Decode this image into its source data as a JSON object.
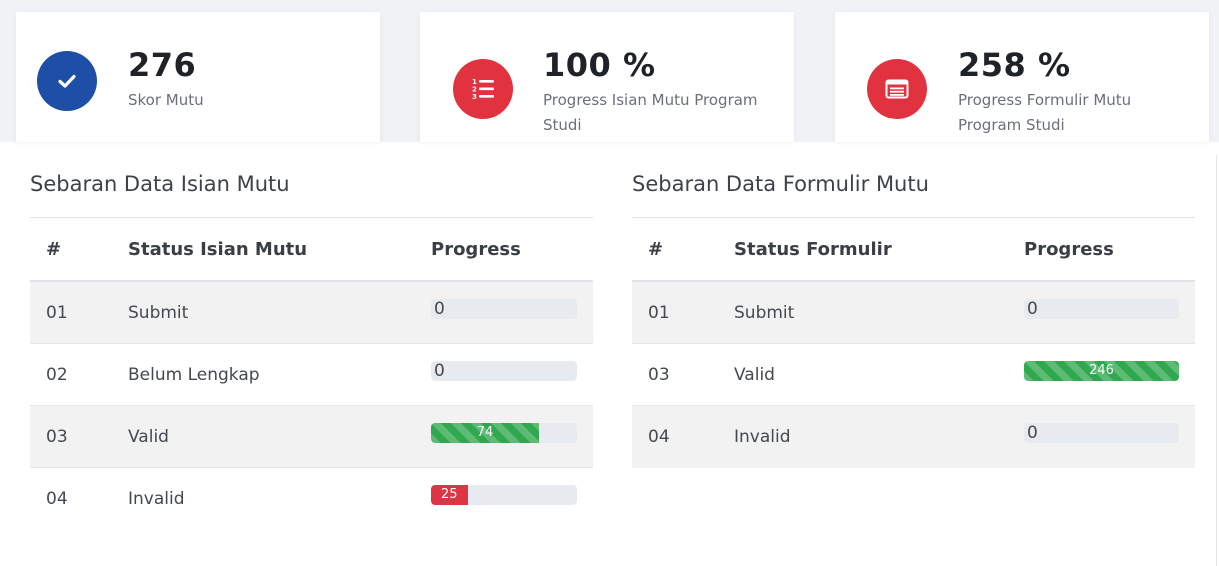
{
  "cards": [
    {
      "value": "276",
      "label": "Skor Mutu",
      "icon": "check-icon",
      "color": "#1e4fa6"
    },
    {
      "value": "100 %",
      "label": "Progress Isian Mutu Program Studi",
      "icon": "numbered-list-icon",
      "color": "#e0323f"
    },
    {
      "value": "258 %",
      "label": "Progress Formulir Mutu Program Studi",
      "icon": "form-list-icon",
      "color": "#e0323f"
    }
  ],
  "isian": {
    "title": "Sebaran Data Isian Mutu",
    "headers": [
      "#",
      "Status Isian Mutu",
      "Progress"
    ],
    "rows": [
      {
        "num": "01",
        "status": "Submit",
        "progress": "0"
      },
      {
        "num": "02",
        "status": "Belum Lengkap",
        "progress": "0"
      },
      {
        "num": "03",
        "status": "Valid",
        "progress": "74"
      },
      {
        "num": "04",
        "status": "Invalid",
        "progress": "25"
      }
    ]
  },
  "formulir": {
    "title": "Sebaran Data Formulir Mutu",
    "headers": [
      "#",
      "Status Formulir",
      "Progress"
    ],
    "rows": [
      {
        "num": "01",
        "status": "Submit",
        "progress": "0"
      },
      {
        "num": "03",
        "status": "Valid",
        "progress": "246"
      },
      {
        "num": "04",
        "status": "Invalid",
        "progress": "0"
      }
    ]
  },
  "colors": {
    "success": "#2fa84f",
    "danger": "#dc3545",
    "primary": "#1e4fa6"
  }
}
